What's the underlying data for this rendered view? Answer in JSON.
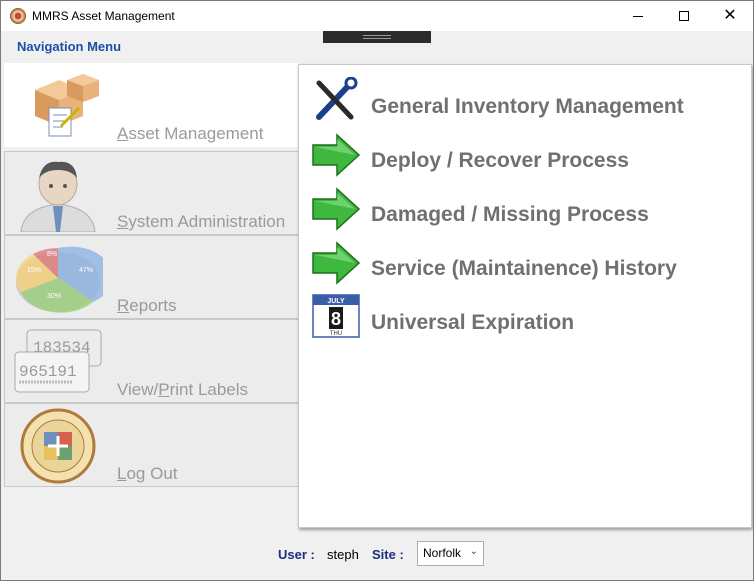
{
  "window": {
    "title": "MMRS Asset Management",
    "minimize_label": "—",
    "maximize_label": "□",
    "close_label": "✕"
  },
  "nav": {
    "heading": "Navigation Menu",
    "items": [
      {
        "first": "A",
        "rest": "sset Management",
        "icon": "boxes-icon",
        "active": true
      },
      {
        "first": "S",
        "rest": "ystem Administration",
        "icon": "admin-user-icon",
        "active": false
      },
      {
        "first": "R",
        "rest": "eports",
        "icon": "pie-chart-icon",
        "active": false
      },
      {
        "first": "View/",
        "u": "P",
        "rest": "rint Labels",
        "icon": "barcode-labels-icon",
        "active": false
      },
      {
        "first": "L",
        "rest": "og Out",
        "icon": "mmrs-seal-icon",
        "active": false
      }
    ]
  },
  "tasks": [
    {
      "label": "General Inventory Management",
      "icon": "tools-icon"
    },
    {
      "label": "Deploy / Recover Process",
      "icon": "green-arrow-icon"
    },
    {
      "label": "Damaged / Missing Process",
      "icon": "green-arrow-icon"
    },
    {
      "label": "Service (Maintainence) History",
      "icon": "green-arrow-icon"
    },
    {
      "label": "Universal Expiration",
      "icon": "calendar-icon"
    }
  ],
  "reports_chart": {
    "slices": [
      {
        "label": "47%",
        "value": 47,
        "color": "#8eb4e3"
      },
      {
        "label": "30%",
        "value": 30,
        "color": "#9bd17a"
      },
      {
        "label": "15%",
        "value": 15,
        "color": "#f7d27c"
      },
      {
        "label": "8%",
        "value": 8,
        "color": "#e07a7a"
      }
    ]
  },
  "calendar": {
    "month": "JULY",
    "day": "8",
    "weekday": "THU"
  },
  "labels_icon": {
    "code1": "183534",
    "code2": "965191"
  },
  "status": {
    "user_label": "User :",
    "user_value": "steph",
    "site_label": "Site :",
    "site_value": "Norfolk"
  }
}
